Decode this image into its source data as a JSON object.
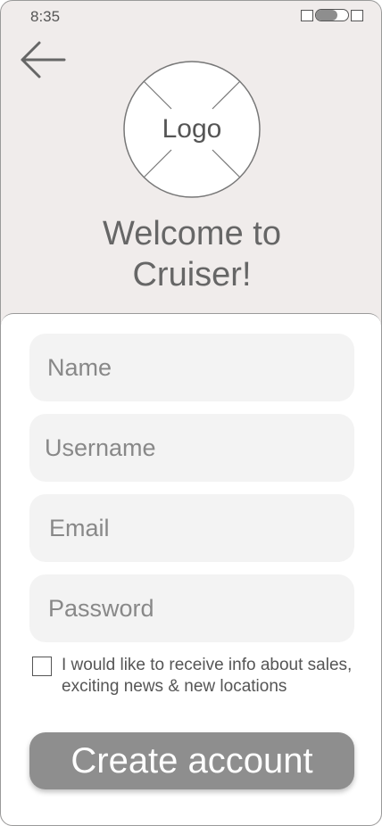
{
  "status_bar": {
    "time": "8:35"
  },
  "logo": {
    "label": "Logo"
  },
  "welcome": {
    "line1": "Welcome to",
    "line2": "Cruiser!"
  },
  "form": {
    "name_placeholder": "Name",
    "username_placeholder": "Username",
    "email_placeholder": "Email",
    "password_placeholder": "Password",
    "consent_checked": false,
    "consent_text": "I would like to receive info about sales, exciting news & new locations",
    "submit_label": "Create account"
  },
  "icons": {
    "back": "arrow-left-icon"
  },
  "colors": {
    "header_bg": "#f0eceb",
    "field_bg": "#f3f3f3",
    "button_bg": "#8e8e8e",
    "text_primary": "#666666"
  }
}
